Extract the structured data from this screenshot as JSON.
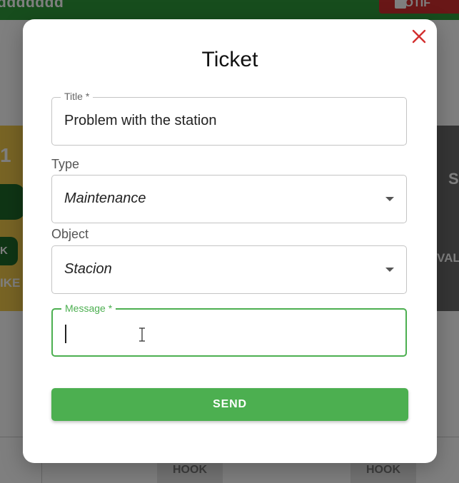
{
  "background": {
    "topbar_title": "ddddddd",
    "topbar_button_label": "NOTIF",
    "left_card_number": "1",
    "left_card_button": "K",
    "left_card_label": "IKE",
    "right_card_letter": "S",
    "right_card_label": "VAL",
    "hook_labels": [
      "HOOK",
      "HOOK"
    ]
  },
  "modal": {
    "title": "Ticket",
    "close_icon": "close-icon",
    "fields": {
      "title": {
        "label": "Title *",
        "value": "Problem with the station"
      },
      "type": {
        "label": "Type",
        "value": "Maintenance"
      },
      "object": {
        "label": "Object",
        "value": "Stacion"
      },
      "message": {
        "label": "Message *",
        "value": ""
      }
    },
    "send_label": "SEND"
  },
  "colors": {
    "accent_green": "#4caf50",
    "close_red": "#d32f2f"
  }
}
